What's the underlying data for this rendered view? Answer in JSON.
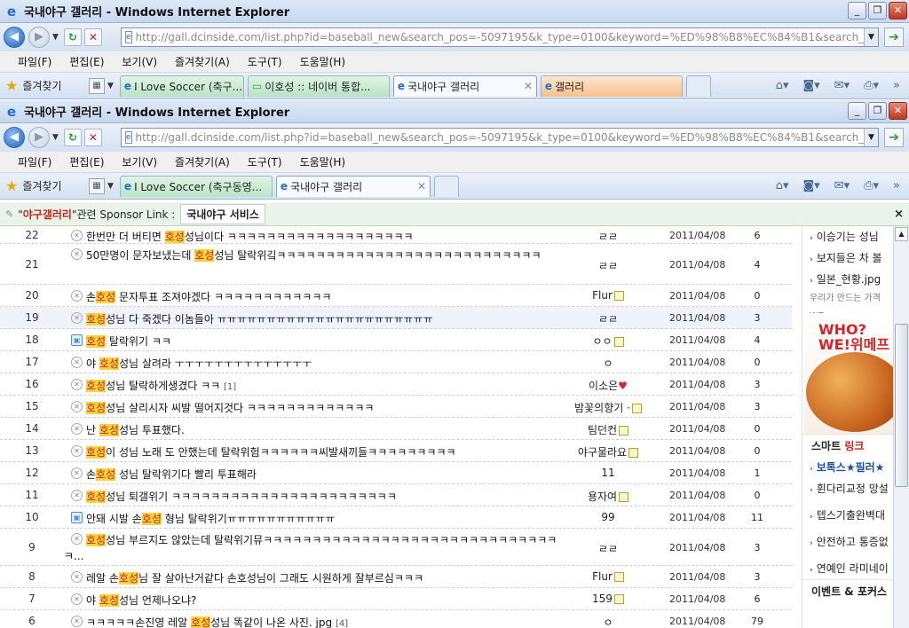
{
  "window1": {
    "title": "국내야구 갤러리 - Windows Internet Explorer",
    "url": "http://gall.dcinside.com/list.php?id=baseball_new&search_pos=-5097195&k_type=0100&keyword=%ED%98%B8%EC%84%B1&search_pos=-5097",
    "tabs": [
      "I Love Soccer (축구...",
      "이호성 :: 네이버 통합...",
      "국내야구 갤러리",
      "갤러리"
    ]
  },
  "window2": {
    "title": "국내야구 갤러리 - Windows Internet Explorer",
    "url": "http://gall.dcinside.com/list.php?id=baseball_new&search_pos=-5097195&k_type=0100&keyword=%ED%98%B8%EC%84%B1&search_pos=-5097",
    "tabs": [
      "I Love Soccer (축구동영...",
      "국내야구 갤러리"
    ]
  },
  "menu": [
    "파일(F)",
    "편집(E)",
    "보기(V)",
    "즐겨찾기(A)",
    "도구(T)",
    "도움말(H)"
  ],
  "favorites_label": "즐겨찾기",
  "sponsor": {
    "quote_open": "\"",
    "highlight": "야구갤러리",
    "quote_close": "\"",
    "text": "관련 Sponsor Link :",
    "service": "국내야구 서비스",
    "close": "×"
  },
  "posts": [
    {
      "num": "22",
      "pre": "한번만 더 버티면 ",
      "hl": "호성",
      "post": "성님이다 ㅋㅋㅋㅋㅋㅋㅋㅋㅋㅋㅋㅋㅋㅋㅋㅋㅋㅋㅋ",
      "comment": "",
      "writer": "ㄹㄹ",
      "badge": "",
      "date": "2011/04/08",
      "hits": "6",
      "icon": "x"
    },
    {
      "num": "21",
      "pre": "50만명이 문자보냈는데 ",
      "hl": "호성",
      "post": "성님 탈락위깈ㅋㅋㅋㅋㅋㅋㅋㅋㅋㅋㅋㅋㅋㅋㅋㅋㅋㅋㅋㅋㅋㅋㅋㅋㅋㅋㅋ",
      "comment": "",
      "writer": "ㄹㄹ",
      "badge": "",
      "date": "2011/04/08",
      "hits": "4",
      "icon": "x"
    },
    {
      "num": "20",
      "pre": "손",
      "hl": "호성",
      "post": " 문자투표 조져야겠다 ㅋㅋㅋㅋㅋㅋㅋㅋㅋㅋㅋㅋ",
      "comment": "",
      "writer": "Flur",
      "badge": "lock",
      "date": "2011/04/08",
      "hits": "0",
      "icon": "x"
    },
    {
      "num": "19",
      "pre": "",
      "hl": "호성",
      "post": "성님 다 죽겠다 이놈들아 ㅠㅠㅠㅠㅠㅠㅠㅠㅠㅠㅠㅠㅠㅠㅠㅠㅠㅠㅠㅠㅠㅠ",
      "comment": "",
      "writer": "ㄹㄹ",
      "badge": "",
      "date": "2011/04/08",
      "hits": "3",
      "icon": "x"
    },
    {
      "num": "18",
      "pre": "",
      "hl": "호성",
      "post": " 탈락위기 ㅋㅋ",
      "comment": "",
      "writer": "ㅇㅇ",
      "badge": "lock",
      "date": "2011/04/08",
      "hits": "4",
      "icon": "img"
    },
    {
      "num": "17",
      "pre": "야 ",
      "hl": "호성",
      "post": "성님 살려라 ㅜㅜㅜㅜㅜㅜㅜㅜㅜㅜㅜㅜㅜㅜ",
      "comment": "",
      "writer": "ㅇ",
      "badge": "",
      "date": "2011/04/08",
      "hits": "0",
      "icon": "x"
    },
    {
      "num": "16",
      "pre": "",
      "hl": "호성",
      "post": "성님 탈락하게생겼다 ㅋㅋ ",
      "comment": "[1]",
      "writer": "이소은",
      "badge": "heart",
      "date": "2011/04/08",
      "hits": "3",
      "icon": "x"
    },
    {
      "num": "15",
      "pre": "",
      "hl": "호성",
      "post": "성님 살리시자 씨발 떨어지것다 ㅋㅋㅋㅋㅋㅋㅋㅋㅋㅋㅋㅋㅋ",
      "comment": "",
      "writer": "밤꽃의향기 ·",
      "badge": "lock",
      "date": "2011/04/08",
      "hits": "3",
      "icon": "x"
    },
    {
      "num": "14",
      "pre": "난 ",
      "hl": "호성",
      "post": "성님 투표했다.",
      "comment": "",
      "writer": "팀던컨",
      "badge": "lock",
      "date": "2011/04/08",
      "hits": "0",
      "icon": "x"
    },
    {
      "num": "13",
      "pre": "",
      "hl": "호성",
      "post": "이 성님 노래 도 안했는데 탈락위험ㅋㅋㅋㅋㅋㅋ씨발새끼들ㅋㅋㅋㅋㅋㅋㅋㅋㅋ",
      "comment": "",
      "writer": "야구물라요",
      "badge": "lock",
      "date": "2011/04/08",
      "hits": "0",
      "icon": "x"
    },
    {
      "num": "12",
      "pre": "손",
      "hl": "호성",
      "post": " 성님 탈락위기다 빨리 투표해라",
      "comment": "",
      "writer": "11",
      "badge": "",
      "date": "2011/04/08",
      "hits": "1",
      "icon": "x"
    },
    {
      "num": "11",
      "pre": "",
      "hl": "호성",
      "post": "성님 퇴갤위기 ㅋㅋㅋㅋㅋㅋㅋㅋㅋㅋㅋㅋㅋㅋㅋㅋㅋㅋㅋㅋㅋㅋㅋ",
      "comment": "",
      "writer": "용자여",
      "badge": "lock",
      "date": "2011/04/08",
      "hits": "0",
      "icon": "x"
    },
    {
      "num": "10",
      "pre": "안돼 시발 손",
      "hl": "호성",
      "post": " 형님 탈락위기ㅠㅠㅠㅠㅠㅠㅠㅠㅠㅠㅠ",
      "comment": "",
      "writer": "99",
      "badge": "",
      "date": "2011/04/08",
      "hits": "11",
      "icon": "img"
    },
    {
      "num": "9",
      "pre": "",
      "hl": "호성",
      "post": "성님 부르지도 않았는데 탈락위기뮤ㅋㅋㅋㅋㅋㅋㅋㅋㅋㅋㅋㅋㅋㅋㅋㅋㅋㅋㅋㅋㅋㅋㅋㅋㅋㅋㅋㅋㅋㅋㅋ...",
      "comment": "",
      "writer": "ㄹㄹ",
      "badge": "",
      "date": "2011/04/08",
      "hits": "3",
      "icon": "x"
    },
    {
      "num": "8",
      "pre": "레알 손",
      "hl": "호성",
      "post": "님 잘 살아난거같다 손호성님이 그래도 시원하게 잘부르심ㅋㅋㅋ",
      "comment": "",
      "writer": "Flur",
      "badge": "lock",
      "date": "2011/04/08",
      "hits": "3",
      "icon": "x"
    },
    {
      "num": "7",
      "pre": "야 ",
      "hl": "호성",
      "post": "성님 언제나오냐?",
      "comment": "",
      "writer": "159",
      "badge": "lock",
      "date": "2011/04/08",
      "hits": "6",
      "icon": "x"
    },
    {
      "num": "6",
      "pre": "ㅋㅋㅋㅋㅋ손진영 레알 ",
      "hl": "호성",
      "post": "성님 똑같이 나온 사진. jpg ",
      "comment": "[4]",
      "writer": "ㅇ",
      "badge": "",
      "date": "2011/04/08",
      "hits": "79",
      "icon": "x"
    }
  ],
  "sidebar": {
    "top_links": [
      "이승기는 성님",
      "보지들은 차 볼",
      "일본_현황.jpg"
    ],
    "tagline": "우리가 만드는 가격 WE",
    "ad_text": [
      "WHO?",
      "WE!위메프"
    ],
    "smart_link_label": "스마트 ",
    "smart_link_red": "링크",
    "links": [
      "보톡스★필러★",
      "휜다리교정 망설",
      "텝스기출완벽대",
      "안전하고 통증없",
      "연예인 라미네이"
    ],
    "event_label": "이벤트 & ",
    "event_bold": "포커스"
  },
  "colors": {
    "highlight_bg": "#ffd23c",
    "highlight_fg": "#c0281c"
  }
}
